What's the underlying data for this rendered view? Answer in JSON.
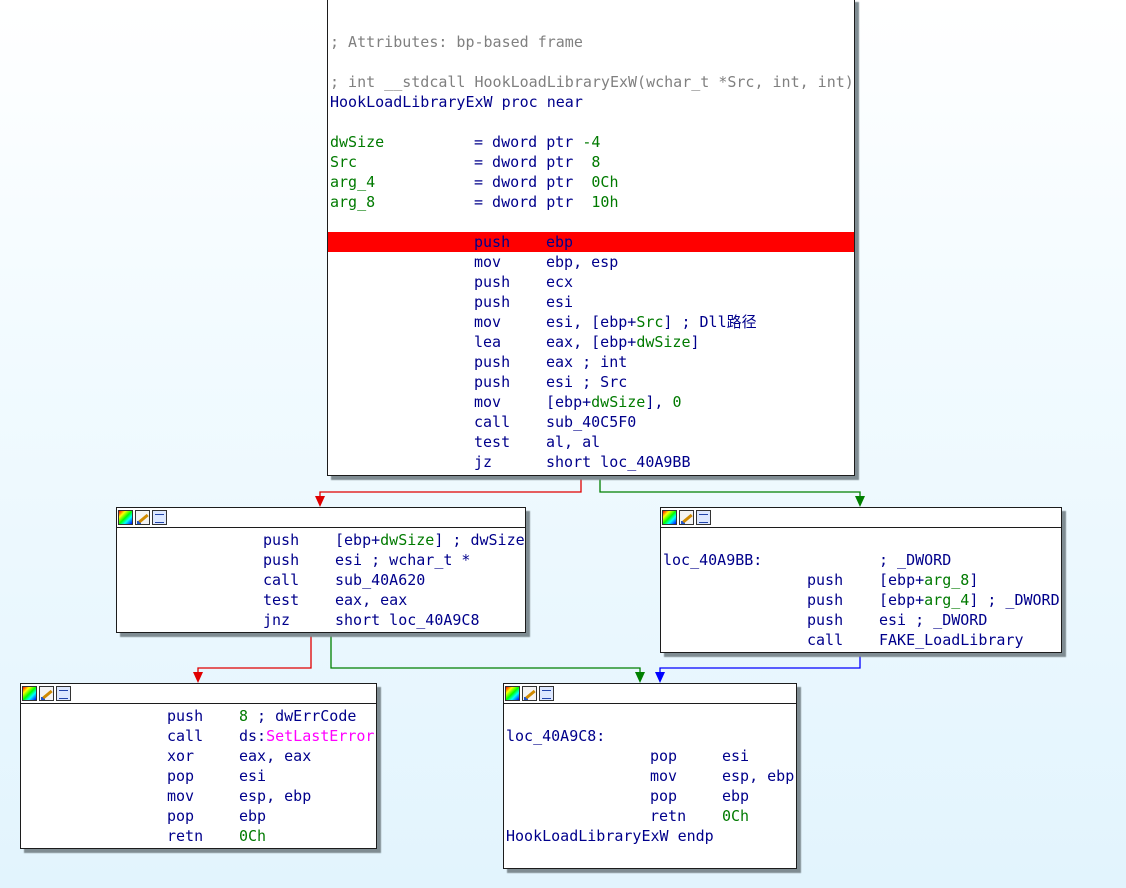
{
  "colors": {
    "background_top": "#ffffff",
    "background_bottom": "#e2f4fd",
    "instruction": "#00008b",
    "comment": "#808080",
    "stack_var": "#007a00",
    "import": "#ff00ff",
    "highlight": "#ff0000",
    "edge_true": "#007a00",
    "edge_false": "#ff0000",
    "edge_uncond": "#0000ff"
  },
  "blocks": {
    "entry": {
      "header": [
        {
          "text": "; Attributes: bp-based frame",
          "kind": "comment"
        },
        {
          "text": "",
          "kind": "blank"
        },
        {
          "text": "; int __stdcall HookLoadLibraryExW(wchar_t *Src, int, int)",
          "kind": "comment"
        },
        {
          "text": "HookLoadLibraryExW proc near",
          "kind": "label"
        },
        {
          "text": "",
          "kind": "blank"
        }
      ],
      "vars": [
        {
          "name": "dwSize",
          "def": "= dword ptr ",
          "val": "-4"
        },
        {
          "name": "Src",
          "def": "= dword ptr ",
          "val": " 8"
        },
        {
          "name": "arg_4",
          "def": "= dword ptr ",
          "val": " 0Ch"
        },
        {
          "name": "arg_8",
          "def": "= dword ptr ",
          "val": " 10h"
        }
      ],
      "instructions": [
        {
          "mn": "push",
          "op": "ebp",
          "highlight": true
        },
        {
          "mn": "mov",
          "op": "ebp, esp"
        },
        {
          "mn": "push",
          "op": "ecx"
        },
        {
          "mn": "push",
          "op": "esi"
        },
        {
          "mn": "mov",
          "op": "esi, [ebp+",
          "op_var": "Src",
          "op_tail": "] ; Dll路径"
        },
        {
          "mn": "lea",
          "op": "eax, [ebp+",
          "op_var": "dwSize",
          "op_tail": "]"
        },
        {
          "mn": "push",
          "op": "eax ; int"
        },
        {
          "mn": "push",
          "op": "esi ; Src"
        },
        {
          "mn": "mov",
          "op": "[ebp+",
          "op_var": "dwSize",
          "op_tail": "], ",
          "op_num": "0"
        },
        {
          "mn": "call",
          "op": "sub_40C5F0"
        },
        {
          "mn": "test",
          "op": "al, al"
        },
        {
          "mn": "jz",
          "op": "short loc_40A9BB"
        }
      ]
    },
    "check": {
      "instructions": [
        {
          "mn": "push",
          "op": "[ebp+",
          "op_var": "dwSize",
          "op_tail": "] ; dwSize"
        },
        {
          "mn": "push",
          "op": "esi ; wchar_t *"
        },
        {
          "mn": "call",
          "op": "sub_40A620"
        },
        {
          "mn": "test",
          "op": "eax, eax"
        },
        {
          "mn": "jnz",
          "op": "short loc_40A9C8"
        }
      ]
    },
    "fake": {
      "label": "loc_40A9BB:",
      "label_comment": "; _DWORD",
      "instructions": [
        {
          "mn": "push",
          "op": "[ebp+",
          "op_var": "arg_8",
          "op_tail": "]"
        },
        {
          "mn": "push",
          "op": "[ebp+",
          "op_var": "arg_4",
          "op_tail": "] ; _DWORD"
        },
        {
          "mn": "push",
          "op": "esi ; _DWORD"
        },
        {
          "mn": "call",
          "op": "FAKE_LoadLibrary"
        }
      ]
    },
    "error": {
      "instructions": [
        {
          "mn": "push",
          "op": "",
          "op_num": "8",
          "op_tail": " ; dwErrCode"
        },
        {
          "mn": "call",
          "op": "ds:",
          "op_import": "SetLastError"
        },
        {
          "mn": "xor",
          "op": "eax, eax"
        },
        {
          "mn": "pop",
          "op": "esi"
        },
        {
          "mn": "mov",
          "op": "esp, ebp"
        },
        {
          "mn": "pop",
          "op": "ebp"
        },
        {
          "mn": "retn",
          "op": "",
          "op_num": "0Ch"
        }
      ]
    },
    "exit": {
      "label": "loc_40A9C8:",
      "instructions": [
        {
          "mn": "pop",
          "op": "esi"
        },
        {
          "mn": "mov",
          "op": "esp, ebp"
        },
        {
          "mn": "pop",
          "op": "ebp"
        },
        {
          "mn": "retn",
          "op": "",
          "op_num": "0Ch"
        }
      ],
      "footer": "HookLoadLibraryExW endp"
    }
  }
}
